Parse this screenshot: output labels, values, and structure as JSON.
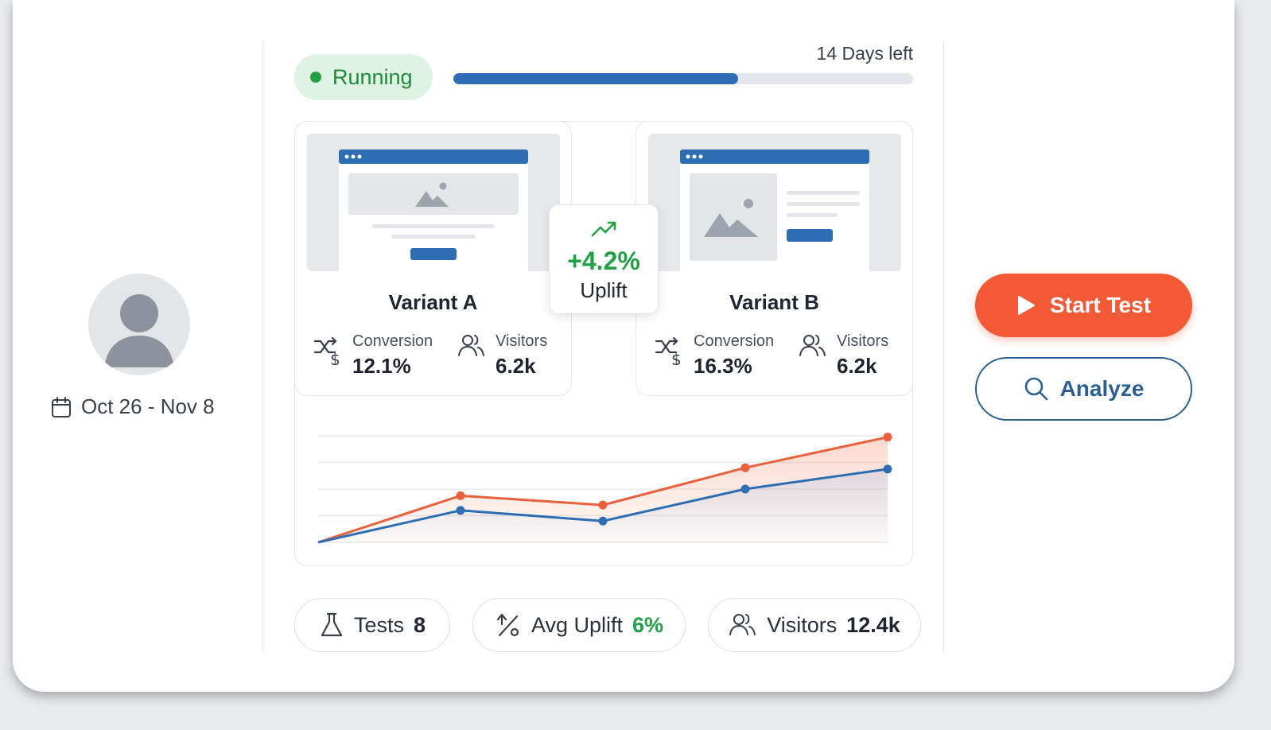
{
  "sidebar": {
    "date_range": "Oct 26 - Nov 8"
  },
  "status": {
    "label": "Running",
    "days_left": "14 Days left",
    "progress": 0.62
  },
  "uplift": {
    "value": "+4.2%",
    "label": "Uplift"
  },
  "variants": [
    {
      "name": "Variant A",
      "conversion_label": "Conversion",
      "conversion_value": "12.1%",
      "visitors_label": "Visitors",
      "visitors_value": "6.2k"
    },
    {
      "name": "Variant B",
      "conversion_label": "Conversion",
      "conversion_value": "16.3%",
      "visitors_label": "Visitors",
      "visitors_value": "6.2k"
    }
  ],
  "chart_data": {
    "type": "line",
    "title": "",
    "xlabel": "",
    "ylabel": "",
    "x": [
      0,
      1,
      2,
      3,
      4
    ],
    "ylim": [
      0,
      4
    ],
    "grid": true,
    "series": [
      {
        "color": "#e8603c",
        "values": [
          0,
          1.75,
          1.4,
          2.8,
          3.95
        ]
      },
      {
        "color": "#2d6eb3",
        "values": [
          0,
          1.2,
          0.8,
          2.0,
          2.75
        ]
      }
    ]
  },
  "stats": {
    "tests_label": "Tests",
    "tests_value": "8",
    "avg_uplift_label": "Avg Uplift",
    "avg_uplift_value": "6%",
    "visitors_label": "Visitors",
    "visitors_value": "12.4k"
  },
  "actions": {
    "start_label": "Start Test",
    "analyze_label": "Analyze"
  },
  "colors": {
    "accent_orange": "#f25a36",
    "accent_blue": "#2d6eb3",
    "success_green": "#23a046"
  }
}
